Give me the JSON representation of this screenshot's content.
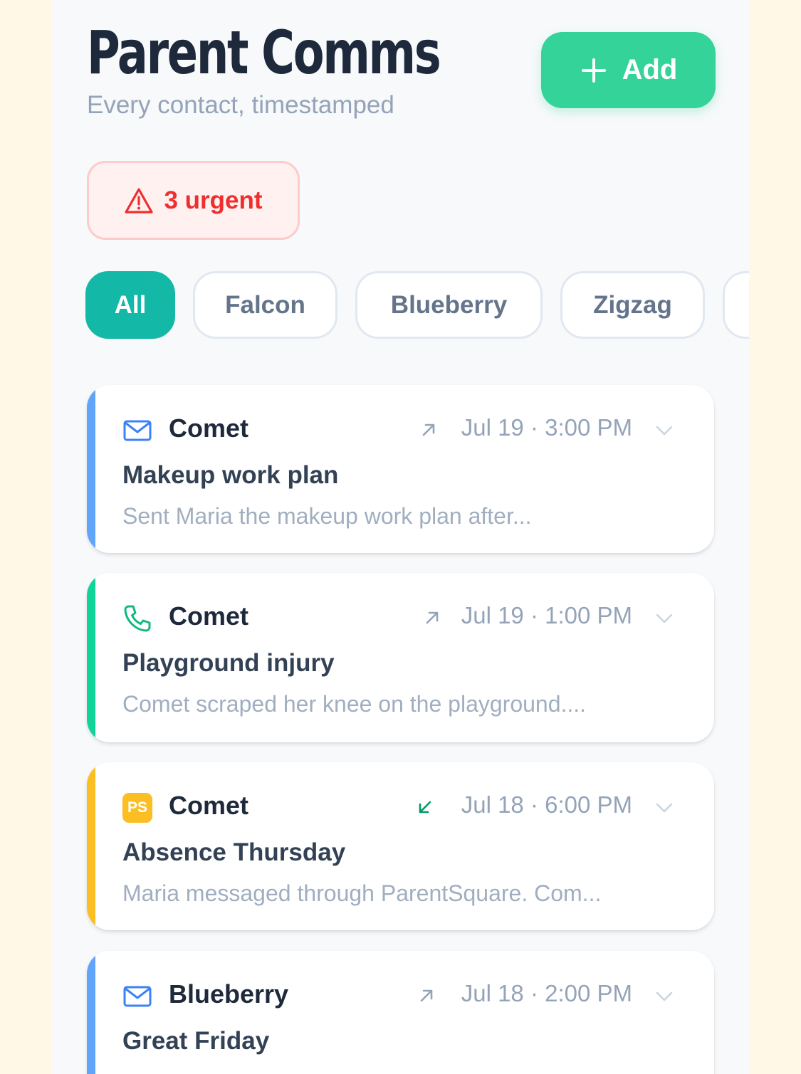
{
  "header": {
    "title": "Parent Comms",
    "subtitle": "Every contact, timestamped",
    "add_label": "Add"
  },
  "urgent": {
    "label": "3 urgent",
    "icon": "alert-triangle-icon"
  },
  "filters": [
    "All",
    "Falcon",
    "Blueberry",
    "Zigzag"
  ],
  "active_filter": "All",
  "colors": {
    "accent_teal": "#14b8a6",
    "add_green": "#34d399",
    "urgent_red": "#ef2f2f",
    "email_blue": "#3b82f6",
    "phone_green": "#10b981",
    "parentsquare_yellow": "#fbbf24"
  },
  "cards": [
    {
      "channel": "email",
      "channel_icon": "mail-icon",
      "student": "Comet",
      "direction": "outgoing",
      "direction_icon": "arrow-up-right-icon",
      "when": "Jul 19 · 3:00 PM",
      "subject": "Makeup work plan",
      "preview": "Sent Maria the makeup work plan after..."
    },
    {
      "channel": "phone",
      "channel_icon": "phone-icon",
      "student": "Comet",
      "direction": "outgoing",
      "direction_icon": "arrow-up-right-icon",
      "when": "Jul 19 · 1:00 PM",
      "subject": "Playground injury",
      "preview": "Comet scraped her knee on the playground...."
    },
    {
      "channel": "parentsquare",
      "channel_icon": "parentsquare-icon",
      "channel_badge": "PS",
      "student": "Comet",
      "direction": "incoming",
      "direction_icon": "arrow-down-left-icon",
      "when": "Jul 18 · 6:00 PM",
      "subject": "Absence Thursday",
      "preview": "Maria messaged through ParentSquare. Com..."
    },
    {
      "channel": "email",
      "channel_icon": "mail-icon",
      "student": "Blueberry",
      "direction": "outgoing",
      "direction_icon": "arrow-up-right-icon",
      "when": "Jul 18 · 2:00 PM",
      "subject": "Great Friday",
      "preview": ""
    }
  ]
}
